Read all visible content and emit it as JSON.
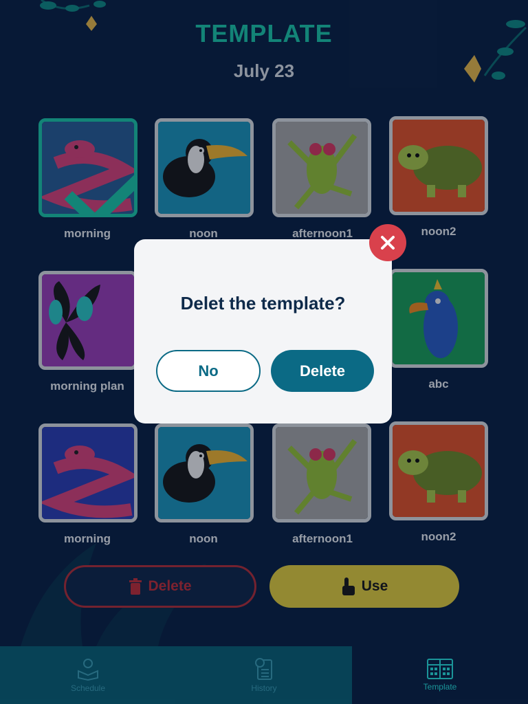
{
  "header": {
    "title": "TEMPLATE",
    "date": "July 23"
  },
  "templates": [
    {
      "label": "morning",
      "animal": "snake-icon",
      "bg": "#2a5f95",
      "selected": true
    },
    {
      "label": "noon",
      "animal": "toucan-icon",
      "bg": "#1e95bb",
      "selected": false
    },
    {
      "label": "afternoon1",
      "animal": "frog-icon",
      "bg": "#a6a6a6",
      "selected": false
    },
    {
      "label": "noon2",
      "animal": "turtle-icon",
      "bg": "#e0542a",
      "selected": false
    },
    {
      "label": "morning plan",
      "animal": "butterfly-icon",
      "bg": "#9a3fb5",
      "selected": false
    },
    {
      "label": "abc",
      "animal": "parrot-icon",
      "bg": "#1c9e5a",
      "selected": false
    },
    {
      "label": "morning",
      "animal": "snake-icon",
      "bg": "#2d3fb2",
      "selected": false
    },
    {
      "label": "noon",
      "animal": "toucan-icon",
      "bg": "#1e95bb",
      "selected": false
    },
    {
      "label": "afternoon1",
      "animal": "frog-icon",
      "bg": "#a6a6a6",
      "selected": false
    },
    {
      "label": "noon2",
      "animal": "turtle-icon",
      "bg": "#e0542a",
      "selected": false
    }
  ],
  "actions": {
    "delete_label": "Delete",
    "use_label": "Use"
  },
  "tabs": [
    {
      "label": "Schedule",
      "icon": "reading-person-icon",
      "active": false
    },
    {
      "label": "History",
      "icon": "history-clipboard-icon",
      "active": false
    },
    {
      "label": "Template",
      "icon": "template-grid-icon",
      "active": true
    }
  ],
  "dialog": {
    "message": "Delet the template?",
    "no_label": "No",
    "delete_label": "Delete"
  },
  "colors": {
    "accent": "#1ec7a8",
    "primary": "#0b6a85",
    "danger": "#d9414c",
    "use": "#e2ce3e"
  }
}
